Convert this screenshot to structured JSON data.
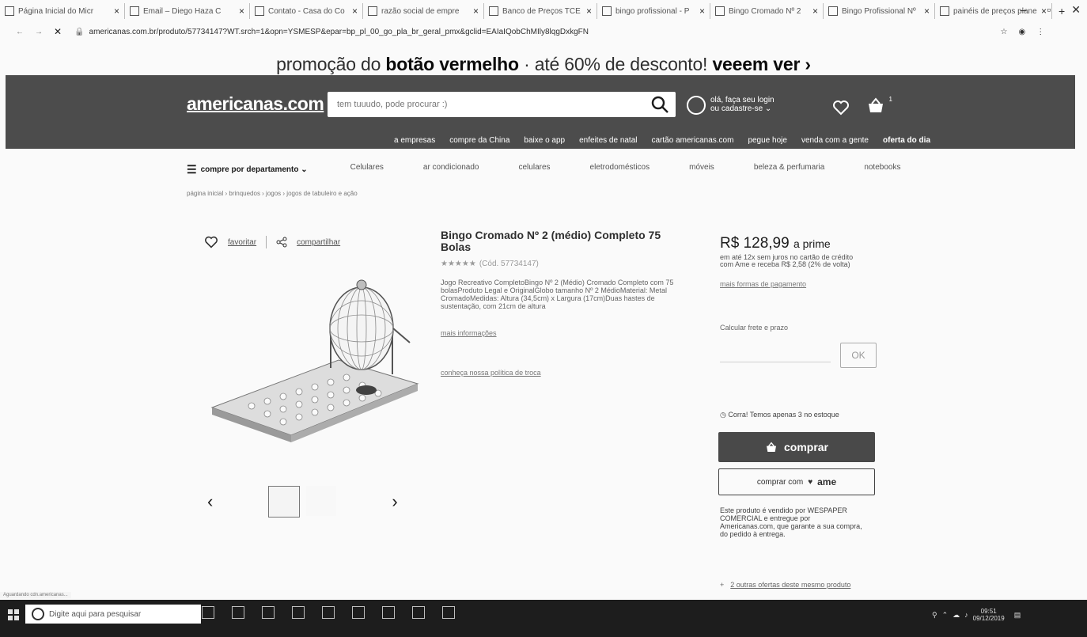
{
  "browser": {
    "tabs": [
      {
        "label": "Página Inicial do Micr"
      },
      {
        "label": "Email – Diego Haza C"
      },
      {
        "label": "Contato - Casa do Co"
      },
      {
        "label": "razão social de empre"
      },
      {
        "label": "Banco de Preços TCE"
      },
      {
        "label": "bingo profissional - P"
      },
      {
        "label": "Bingo Cromado Nº 2"
      },
      {
        "label": "Bingo Profissional Nº"
      },
      {
        "label": "painéis de preços plane"
      }
    ],
    "new_tab": "+",
    "url": "americanas.com.br/produto/57734147?WT.srch=1&opn=YSMESP&epar=bp_pl_00_go_pla_br_geral_pmx&gclid=EAIaIQobChMIly8lqgDxkgFN",
    "status_text": "Aguardando cdn.americanas..."
  },
  "promo": {
    "prefix": "promoção do",
    "bold": "botão vermelho",
    "middle": " · até 60% de desconto!",
    "cta": "veeem ver ›"
  },
  "header": {
    "logo": "americanas.com",
    "search_placeholder": "tem tuuudo, pode procurar :)",
    "login_line1": "olá, faça seu login",
    "login_line2": "ou cadastre-se ⌄",
    "basket_count": "1"
  },
  "nav": {
    "items": [
      "a empresas",
      "compre da China",
      "baixe o app",
      "enfeites de natal",
      "cartão americanas.com",
      "pegue hoje",
      "venda com a gente",
      "oferta do dia"
    ]
  },
  "departments": {
    "label": "compre por departamento ⌄",
    "items": [
      "Celulares",
      "ar condicionado",
      "celulares",
      "eletrodomésticos",
      "móveis",
      "beleza & perfumaria",
      "notebooks"
    ]
  },
  "breadcrumb": "página inicial  ›  brinquedos  ›  jogos  ›  jogos de tabuleiro e ação",
  "product": {
    "favorite_label": "favoritar",
    "share_label": "compartilhar",
    "title": "Bingo Cromado Nº 2 (médio) Completo 75 Bolas",
    "code": "(Cód. 57734147)",
    "description": "Jogo Recreativo CompletoBingo Nº 2 (Médio) Cromado Completo com 75 bolasProduto Legal e OriginalGlobo tamanho Nº 2 MédioMaterial: Metal CromadoMedidas: Altura (34,5cm) x Largura (17cm)Duas hastes de sustentação, com 21cm de altura",
    "more_info": "mais informações",
    "policy": "conheça nossa política de troca",
    "thumb_prev": "‹",
    "thumb_next": "›"
  },
  "purchase": {
    "price": "R$ 128,99",
    "prime": "a prime",
    "installments": "em até 12x sem juros no cartão de crédito",
    "cashback": "com Ame e receba R$ 2,58 (2% de volta)",
    "more_payment": "mais formas de pagamento",
    "shipping_label": "Calcular frete e prazo",
    "cep_button": "OK",
    "stock_warning": "Corra! Temos apenas 3 no estoque",
    "buy_label": "comprar",
    "ame_label": "comprar com",
    "ame_brand": "ame",
    "seller_text": "Este produto é vendido por WESPAPER COMERCIAL e entregue por Americanas.com, que garante a sua compra, do pedido à entrega.",
    "other_offers": "2 outras ofertas deste mesmo produto"
  },
  "taskbar": {
    "search_placeholder": "Digite aqui para pesquisar",
    "time": "09:51",
    "date": "09/12/2019"
  }
}
